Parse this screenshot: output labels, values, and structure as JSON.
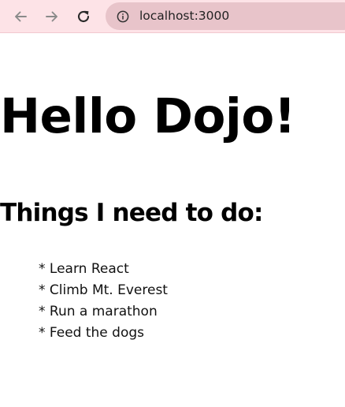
{
  "browser": {
    "url": "localhost:3000",
    "icons": {
      "back": "arrow-left-icon",
      "forward": "arrow-right-icon",
      "reload": "reload-icon",
      "site_info": "info-icon"
    },
    "colors": {
      "toolbar_background": "#fde3e7",
      "omnibox_background": "#e8c4ca"
    }
  },
  "page": {
    "heading": "Hello Dojo!",
    "subheading": "Things I need to do:",
    "todos": [
      "* Learn React",
      "* Climb Mt. Everest",
      "* Run a marathon",
      "* Feed the dogs"
    ]
  }
}
